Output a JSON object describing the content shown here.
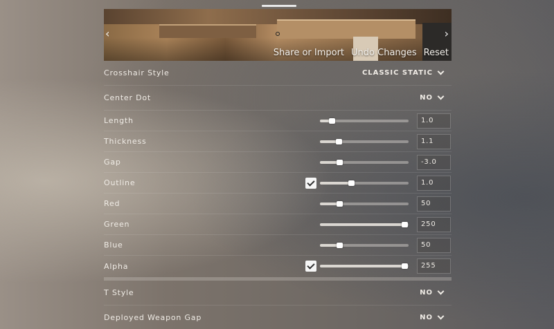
{
  "preview": {
    "nav_left": "‹",
    "nav_right": "›",
    "actions": {
      "share_import": "Share or Import",
      "undo": "Undo Changes",
      "reset": "Reset"
    }
  },
  "dropdowns_top": [
    {
      "label": "Crosshair Style",
      "value": "CLASSIC STATIC"
    },
    {
      "label": "Center Dot",
      "value": "NO"
    }
  ],
  "sliders": [
    {
      "label": "Length",
      "value": "1.0",
      "fraction": 0.13,
      "checkbox": false
    },
    {
      "label": "Thickness",
      "value": "1.1",
      "fraction": 0.21,
      "checkbox": false
    },
    {
      "label": "Gap",
      "value": "-3.0",
      "fraction": 0.22,
      "checkbox": false
    },
    {
      "label": "Outline",
      "value": "1.0",
      "fraction": 0.35,
      "checkbox": true
    },
    {
      "label": "Red",
      "value": "50",
      "fraction": 0.22,
      "checkbox": false
    },
    {
      "label": "Green",
      "value": "250",
      "fraction": 0.95,
      "checkbox": false
    },
    {
      "label": "Blue",
      "value": "50",
      "fraction": 0.22,
      "checkbox": false
    },
    {
      "label": "Alpha",
      "value": "255",
      "fraction": 0.95,
      "checkbox": true
    }
  ],
  "dropdowns_bottom": [
    {
      "label": "T Style",
      "value": "NO"
    },
    {
      "label": "Deployed Weapon Gap",
      "value": "NO"
    }
  ]
}
